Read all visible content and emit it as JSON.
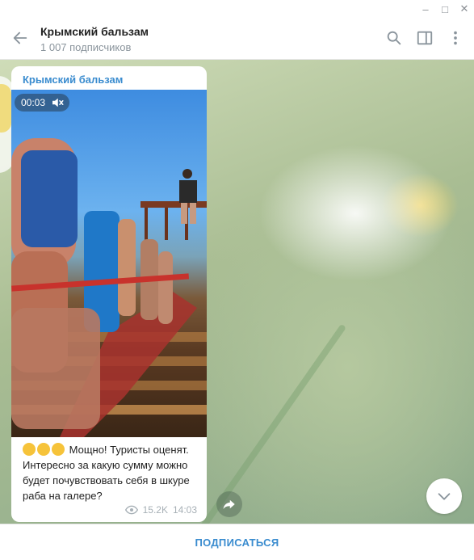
{
  "window": {
    "minimize_glyph": "–",
    "maximize_glyph": "□",
    "close_glyph": "✕"
  },
  "header": {
    "title": "Крымский бальзам",
    "subtitle": "1 007 подписчиков",
    "icons": [
      "back-arrow-icon",
      "search-icon",
      "sidebar-toggle-icon",
      "more-vertical-icon"
    ]
  },
  "message": {
    "channel_name": "Крымский бальзам",
    "video": {
      "time": "00:03",
      "muted": true
    },
    "text": "😂😂😂 Мощно! Туристы оценят. Интересно за какую сумму можно будет почувствовать себя в шкуре раба на галере?",
    "text_after_emoji": "Мощно! Туристы оценят. Интересно за какую сумму можно будет почувствовать себя в шкуре раба на галере?",
    "views": "15.2K",
    "time": "14:03"
  },
  "footer": {
    "subscribe_label": "ПОДПИСАТЬСЯ"
  },
  "colors": {
    "accent": "#3a8ccf",
    "meta": "#a7b0b6"
  }
}
